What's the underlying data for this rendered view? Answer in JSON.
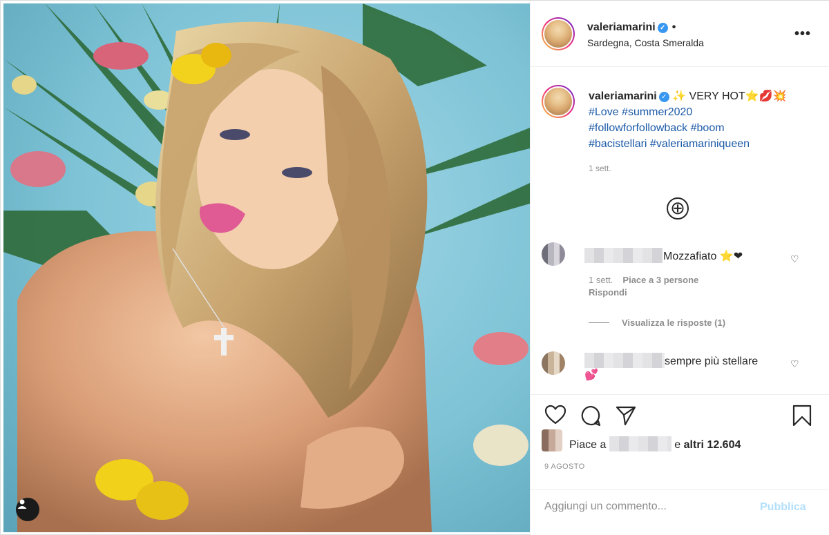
{
  "post": {
    "username": "valeriamarini",
    "location": "Sardegna, Costa Smeralda",
    "more_label": "•••",
    "separator": "•"
  },
  "caption": {
    "username": "valeriamarini",
    "text": "✨ VERY HOT⭐💋💥",
    "hashtags_line1": "#Love #summer2020",
    "hashtags_line2": "#followforfollowback #boom",
    "hashtags_line3": "#bacistellari #valeriamariniqueen",
    "time": "1 sett."
  },
  "load_more_label": "⊕",
  "comments": [
    {
      "text": "Mozzafiato ⭐❤",
      "time": "1 sett.",
      "likes": "Piace a 3 persone",
      "reply_label": "Rispondi",
      "view_replies": "Visualizza le risposte (1)"
    },
    {
      "text": "sempre più stellare",
      "emoji": "💕"
    }
  ],
  "likes": {
    "prefix": "Piace a",
    "suffix_pre": "e",
    "suffix_bold": "altri 12.604"
  },
  "date": "9 AGOSTO",
  "add_comment": {
    "placeholder": "Aggiungi un commento...",
    "publish_label": "Pubblica"
  },
  "colors": {
    "link": "#1c5aa8",
    "publish_disabled": "#b2dffc",
    "verified": "#3897f0"
  }
}
